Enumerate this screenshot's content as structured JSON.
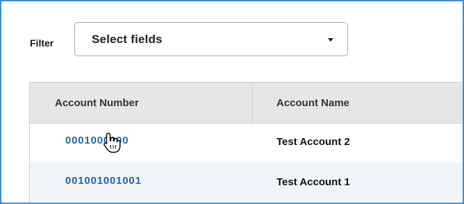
{
  "filter": {
    "label": "Filter",
    "select_value": "Select fields",
    "caret_icon": "chevron-down-icon"
  },
  "table": {
    "columns": [
      "Account Number",
      "Account Name"
    ],
    "rows": [
      {
        "account_number": "0001000000",
        "account_name": "Test Account 2"
      },
      {
        "account_number": "001001001001",
        "account_name": "Test Account 1"
      }
    ]
  },
  "colors": {
    "frame_border": "#3a8fd6",
    "link": "#2266a8",
    "header_bg": "#e6e6e6",
    "row_alt_bg": "#f2f5f8"
  },
  "cursor": {
    "icon": "hand-pointer-icon"
  }
}
